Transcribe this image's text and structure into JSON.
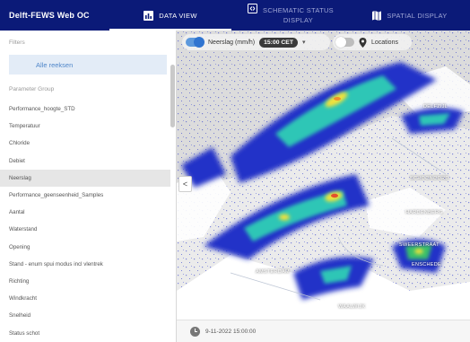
{
  "topbar": {
    "app_title": "Delft-FEWS Web OC",
    "tabs": [
      {
        "label": "DATA VIEW",
        "icon": "chart-icon",
        "active": true
      },
      {
        "label_line1": "SCHEMATIC STATUS",
        "label_line2": "DISPLAY",
        "icon": "schematic-icon",
        "active": false
      },
      {
        "label": "SPATIAL DISPLAY",
        "icon": "map-icon",
        "active": false
      }
    ],
    "background": "#0b1a78"
  },
  "sidebar": {
    "filters_heading": "Filters",
    "selected_filter": "Alle reeksen",
    "parameter_group_heading": "Parameter Group",
    "items": [
      "Performance_hoogte_STD",
      "Temperatuur",
      "Chloride",
      "Debiet",
      "Neerslag",
      "Performance_geenseenheid_Samples",
      "Aantal",
      "Waterstand",
      "Opening",
      "Stand - enum spui modus incl vlentrek",
      "Richting",
      "Windkracht",
      "Snelheid",
      "Status schot"
    ],
    "selected_item": "Neerslag"
  },
  "map": {
    "layer_label": "Neerslag (mm/h)",
    "time_label": "15:00 CET",
    "locations_label": "Locations",
    "collapse_label": "<",
    "places": [
      "DELFZIJL",
      "SCHOONOORD",
      "HARDENBERG",
      "SWEERSTRAAT",
      "ENSCHEDE",
      "AMSTERDAM",
      "WAALWIJK"
    ],
    "colors": {
      "accent": "#2f74d0",
      "rain_low": "#2230c8",
      "rain_mid": "#2fc6b6",
      "rain_high": "#f2e23a"
    }
  },
  "timebar": {
    "datetime": "9-11-2022 15:00:00"
  }
}
